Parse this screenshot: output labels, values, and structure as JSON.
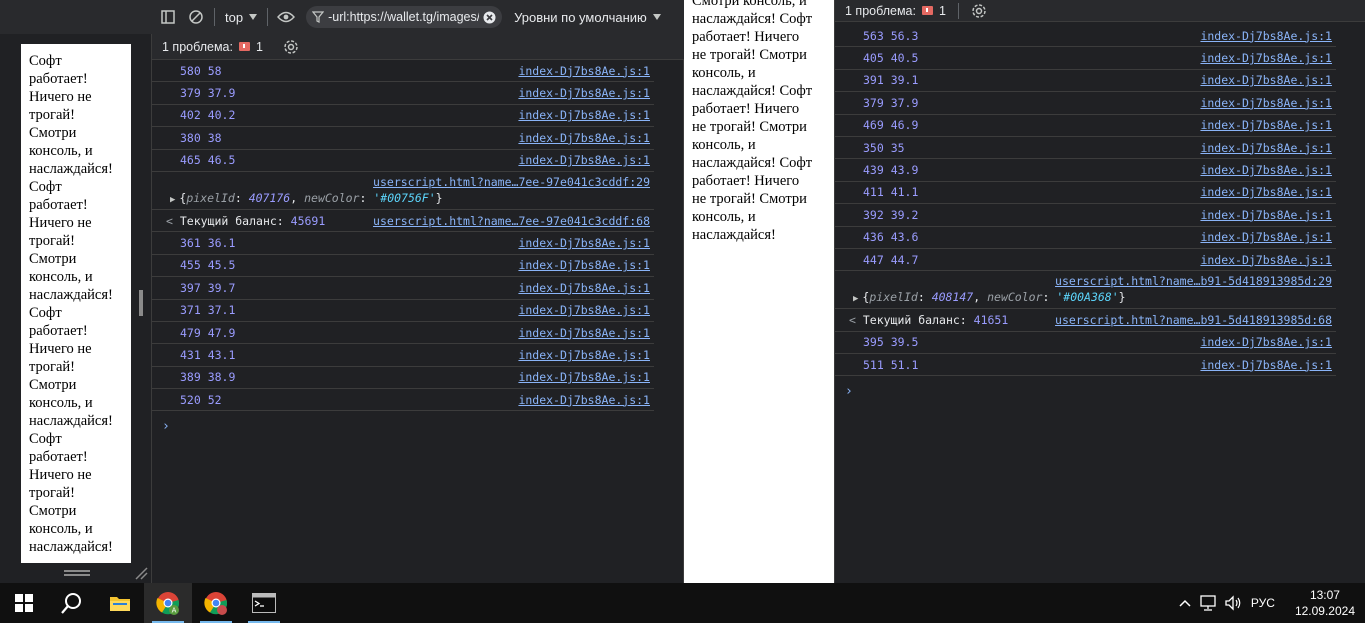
{
  "left_page": {
    "text_lines": [
      "Софт",
      "работает!",
      "Ничего не",
      "трогай!",
      "Смотри",
      "консоль, и",
      "наслаждайся!",
      "Софт",
      "работает!",
      "Ничего не",
      "трогай!",
      "Смотри",
      "консоль, и",
      "наслаждайся!",
      "Софт",
      "работает!",
      "Ничего не",
      "трогай!",
      "Смотри",
      "консоль, и",
      "наслаждайся!",
      "Софт",
      "работает!",
      "Ничего не",
      "трогай!",
      "Смотри",
      "консоль, и",
      "наслаждайся!"
    ]
  },
  "devtools1": {
    "toolbar": {
      "context": "top",
      "filter_value": "-url:https://wallet.tg/images/",
      "levels": "Уровни по умолчанию"
    },
    "issues": {
      "label": "1 проблема:",
      "count": "1"
    },
    "rows": [
      {
        "kind": "log",
        "value": "580 58",
        "src": "index-Dj7bs8Ae.js:1"
      },
      {
        "kind": "log",
        "value": "379 37.9",
        "src": "index-Dj7bs8Ae.js:1"
      },
      {
        "kind": "log",
        "value": "402 40.2",
        "src": "index-Dj7bs8Ae.js:1"
      },
      {
        "kind": "log",
        "value": "380 38",
        "src": "index-Dj7bs8Ae.js:1"
      },
      {
        "kind": "log",
        "value": "465 46.5",
        "src": "index-Dj7bs8Ae.js:1"
      },
      {
        "kind": "obj",
        "pixelId": "407176",
        "newColor": "'#00756F'",
        "src": "userscript.html?name…7ee-97e041c3cddf:29"
      },
      {
        "kind": "ret",
        "label": "Текущий баланс:",
        "value": "45691",
        "src": "userscript.html?name…7ee-97e041c3cddf:68"
      },
      {
        "kind": "log",
        "value": "361 36.1",
        "src": "index-Dj7bs8Ae.js:1"
      },
      {
        "kind": "log",
        "value": "455 45.5",
        "src": "index-Dj7bs8Ae.js:1"
      },
      {
        "kind": "log",
        "value": "397 39.7",
        "src": "index-Dj7bs8Ae.js:1"
      },
      {
        "kind": "log",
        "value": "371 37.1",
        "src": "index-Dj7bs8Ae.js:1"
      },
      {
        "kind": "log",
        "value": "479 47.9",
        "src": "index-Dj7bs8Ae.js:1"
      },
      {
        "kind": "log",
        "value": "431 43.1",
        "src": "index-Dj7bs8Ae.js:1"
      },
      {
        "kind": "log",
        "value": "389 38.9",
        "src": "index-Dj7bs8Ae.js:1"
      },
      {
        "kind": "log",
        "value": "520 52",
        "src": "index-Dj7bs8Ae.js:1"
      }
    ]
  },
  "mid_page": {
    "text_lines": [
      "Смотри консоль, и",
      "наслаждайся! Софт",
      "работает! Ничего",
      "не трогай! Смотри",
      "консоль, и",
      "наслаждайся! Софт",
      "работает! Ничего",
      "не трогай! Смотри",
      "консоль, и",
      "наслаждайся! Софт",
      "работает! Ничего",
      "не трогай! Смотри",
      "консоль, и",
      "наслаждайся!"
    ]
  },
  "devtools2": {
    "issues": {
      "label": "1 проблема:",
      "count": "1"
    },
    "rows": [
      {
        "kind": "log",
        "value": "563 56.3",
        "src": "index-Dj7bs8Ae.js:1"
      },
      {
        "kind": "log",
        "value": "405 40.5",
        "src": "index-Dj7bs8Ae.js:1"
      },
      {
        "kind": "log",
        "value": "391 39.1",
        "src": "index-Dj7bs8Ae.js:1"
      },
      {
        "kind": "log",
        "value": "379 37.9",
        "src": "index-Dj7bs8Ae.js:1"
      },
      {
        "kind": "log",
        "value": "469 46.9",
        "src": "index-Dj7bs8Ae.js:1"
      },
      {
        "kind": "log",
        "value": "350 35",
        "src": "index-Dj7bs8Ae.js:1"
      },
      {
        "kind": "log",
        "value": "439 43.9",
        "src": "index-Dj7bs8Ae.js:1"
      },
      {
        "kind": "log",
        "value": "411 41.1",
        "src": "index-Dj7bs8Ae.js:1"
      },
      {
        "kind": "log",
        "value": "392 39.2",
        "src": "index-Dj7bs8Ae.js:1"
      },
      {
        "kind": "log",
        "value": "436 43.6",
        "src": "index-Dj7bs8Ae.js:1"
      },
      {
        "kind": "log",
        "value": "447 44.7",
        "src": "index-Dj7bs8Ae.js:1"
      },
      {
        "kind": "obj",
        "pixelId": "408147",
        "newColor": "'#00A368'",
        "src": "userscript.html?name…b91-5d418913985d:29"
      },
      {
        "kind": "ret",
        "label": "Текущий баланс:",
        "value": "41651",
        "src": "userscript.html?name…b91-5d418913985d:68"
      },
      {
        "kind": "log",
        "value": "395 39.5",
        "src": "index-Dj7bs8Ae.js:1"
      },
      {
        "kind": "log",
        "value": "511 51.1",
        "src": "index-Dj7bs8Ae.js:1"
      }
    ]
  },
  "taskbar": {
    "apps": [
      {
        "name": "start-icon",
        "active": false
      },
      {
        "name": "search-icon",
        "active": false
      },
      {
        "name": "file-explorer-icon",
        "active": false
      },
      {
        "name": "chrome-profile-icon",
        "active": true
      },
      {
        "name": "chrome-icon",
        "active": false
      },
      {
        "name": "terminal-icon",
        "active": false
      }
    ],
    "tray": {
      "language": "РУС",
      "time": "13:07",
      "date": "12.09.2024"
    }
  },
  "colors": {
    "console_bg": "#202124",
    "toolbar_bg": "#292a2d",
    "link": "#8ab4f8",
    "number": "#9a9cff",
    "string": "#5cd5fb",
    "issue_red": "#e46962"
  }
}
